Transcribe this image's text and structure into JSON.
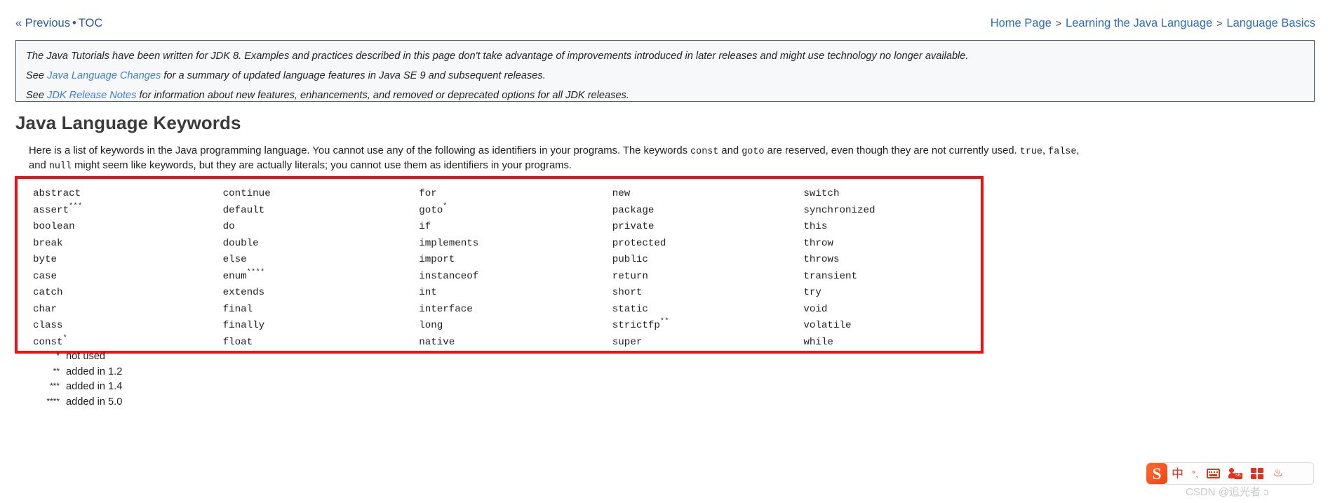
{
  "topnav": {
    "previous_label": "« Previous",
    "separator": "•",
    "toc_label": "TOC"
  },
  "breadcrumb": {
    "separator": ">",
    "items": [
      {
        "label": "Home Page"
      },
      {
        "label": "Learning the Java Language"
      },
      {
        "label": "Language Basics"
      }
    ]
  },
  "notice": {
    "line1_a": "The Java Tutorials have been written for JDK 8. Examples and practices described in this page don't take advantage of improvements introduced in later releases and might use technology no longer available.",
    "line2_pre": "See ",
    "line2_link": "Java Language Changes",
    "line2_post": " for a summary of updated language features in Java SE 9 and subsequent releases.",
    "line3_pre": "See ",
    "line3_link": "JDK Release Notes",
    "line3_post": " for information about new features, enhancements, and removed or deprecated options for all JDK releases."
  },
  "page_title": "Java Language Keywords",
  "intro": {
    "seg1": "Here is a list of keywords in the Java programming language. You cannot use any of the following as identifiers in your programs. The keywords ",
    "code1": "const",
    "seg2": " and ",
    "code2": "goto",
    "seg3": " are reserved, even though they are not currently used. ",
    "code3": "true",
    "seg4": ", ",
    "code4": "false",
    "seg5": ", and ",
    "code5": "null",
    "seg6": " might seem like keywords, but they are actually literals; you cannot use them as identifiers in your programs."
  },
  "keywords": {
    "highlight_color": "#f30f0f",
    "columns": [
      [
        {
          "word": "abstract",
          "note": ""
        },
        {
          "word": "assert",
          "note": "***"
        },
        {
          "word": "boolean",
          "note": ""
        },
        {
          "word": "break",
          "note": ""
        },
        {
          "word": "byte",
          "note": ""
        },
        {
          "word": "case",
          "note": ""
        },
        {
          "word": "catch",
          "note": ""
        },
        {
          "word": "char",
          "note": ""
        },
        {
          "word": "class",
          "note": ""
        },
        {
          "word": "const",
          "note": "*"
        }
      ],
      [
        {
          "word": "continue",
          "note": ""
        },
        {
          "word": "default",
          "note": ""
        },
        {
          "word": "do",
          "note": ""
        },
        {
          "word": "double",
          "note": ""
        },
        {
          "word": "else",
          "note": ""
        },
        {
          "word": "enum",
          "note": "****"
        },
        {
          "word": "extends",
          "note": ""
        },
        {
          "word": "final",
          "note": ""
        },
        {
          "word": "finally",
          "note": ""
        },
        {
          "word": "float",
          "note": ""
        }
      ],
      [
        {
          "word": "for",
          "note": ""
        },
        {
          "word": "goto",
          "note": "*"
        },
        {
          "word": "if",
          "note": ""
        },
        {
          "word": "implements",
          "note": ""
        },
        {
          "word": "import",
          "note": ""
        },
        {
          "word": "instanceof",
          "note": ""
        },
        {
          "word": "int",
          "note": ""
        },
        {
          "word": "interface",
          "note": ""
        },
        {
          "word": "long",
          "note": ""
        },
        {
          "word": "native",
          "note": ""
        }
      ],
      [
        {
          "word": "new",
          "note": ""
        },
        {
          "word": "package",
          "note": ""
        },
        {
          "word": "private",
          "note": ""
        },
        {
          "word": "protected",
          "note": ""
        },
        {
          "word": "public",
          "note": ""
        },
        {
          "word": "return",
          "note": ""
        },
        {
          "word": "short",
          "note": ""
        },
        {
          "word": "static",
          "note": ""
        },
        {
          "word": "strictfp",
          "note": "**"
        },
        {
          "word": "super",
          "note": ""
        }
      ],
      [
        {
          "word": "switch",
          "note": ""
        },
        {
          "word": "synchronized",
          "note": ""
        },
        {
          "word": "this",
          "note": ""
        },
        {
          "word": "throw",
          "note": ""
        },
        {
          "word": "throws",
          "note": ""
        },
        {
          "word": "transient",
          "note": ""
        },
        {
          "word": "try",
          "note": ""
        },
        {
          "word": "void",
          "note": ""
        },
        {
          "word": "volatile",
          "note": ""
        },
        {
          "word": "while",
          "note": ""
        }
      ]
    ]
  },
  "footnotes": [
    {
      "mark": "*",
      "text": "not used"
    },
    {
      "mark": "**",
      "text": "added in 1.2"
    },
    {
      "mark": "***",
      "text": "added in 1.4"
    },
    {
      "mark": "****",
      "text": "added in 5.0"
    }
  ],
  "ime": {
    "logo_label": "S",
    "mode_label": "中",
    "punctuation_label": "°,",
    "keyboard_icon": "keyboard-icon",
    "user_badge_label": "SB",
    "toolbox_icon": "app-grid-icon",
    "skin_icon": "fox-icon"
  },
  "watermark": "CSDN @追光者 ɔ"
}
